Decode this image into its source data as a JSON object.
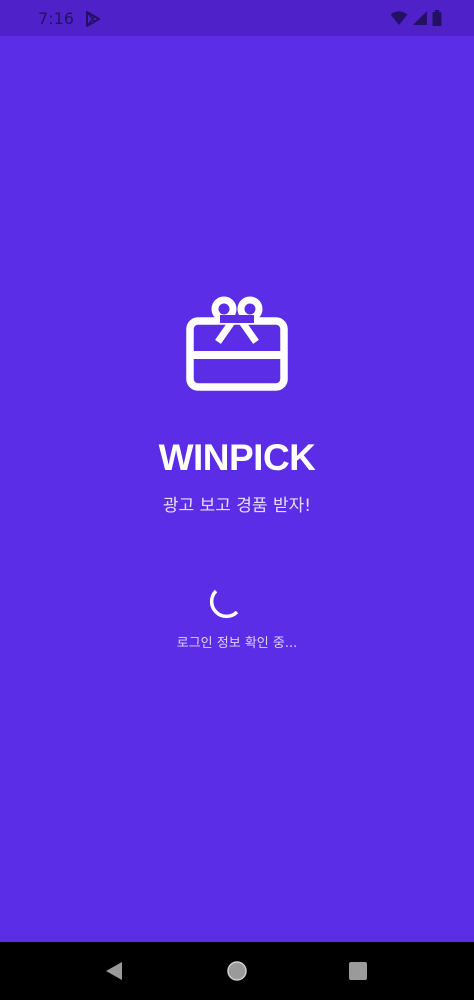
{
  "status_bar": {
    "time": "7:16",
    "icons": [
      "play-store-icon",
      "wifi-icon",
      "signal-icon",
      "battery-icon"
    ]
  },
  "splash": {
    "logo_icon": "gift-icon",
    "title": "WINPICK",
    "subtitle": "광고 보고 경품 받자!",
    "loading_text": "로그인 정보 확인 중..."
  },
  "nav_bar": {
    "icons": [
      "back-icon",
      "home-icon",
      "recents-icon"
    ]
  },
  "colors": {
    "background": "#5b2de6",
    "status_bar": "#4f22c9",
    "text": "#ffffff",
    "nav_bar": "#000000"
  }
}
